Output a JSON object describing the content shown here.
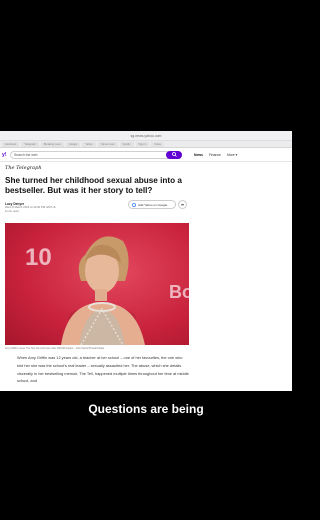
{
  "browser": {
    "url": "sg.news.yahoo.com",
    "tabs": [
      "Facebook",
      "Telegraph",
      "Breaking news",
      "Google",
      "Yahoo",
      "Yahoo news",
      "Spotify",
      "Sign in",
      "News"
    ]
  },
  "yahoo": {
    "logo": "y!",
    "search_placeholder": "Search the web",
    "nav": [
      {
        "label": "News",
        "active": true
      },
      {
        "label": "Finance",
        "active": false
      },
      {
        "label": "More ▾",
        "active": false
      }
    ]
  },
  "article": {
    "source": "The Telegraph",
    "headline": "She turned her childhood sexual abuse into a bestseller. But was it her story to tell?",
    "author": "Lucy Denyer",
    "date": "Wed, 8 March 2023 at 10:00 PM GMT+8",
    "read_time": "6-min read",
    "add_google_label": "Add Yahoo on Google",
    "caption": "Amy Griffin's novel, The Tell, has sold more than 300,000 copies – John Nacion/Pivotal Media",
    "body": "When Amy Griffin was 12 years old, a teacher at her school – one of her favourites, the one who told her she was the school's real leader – sexually assaulted her. The abuse, which she details viscerally in her bestselling memoir, The Tell, happened multiple times throughout her time at middle school, and"
  },
  "photo": {
    "sign_left": "10",
    "sign_right": "Bo"
  },
  "overlay": {
    "caption": "Questions are being"
  },
  "colors": {
    "accent": "#6001d2",
    "photo_bg": "#c8223c"
  }
}
